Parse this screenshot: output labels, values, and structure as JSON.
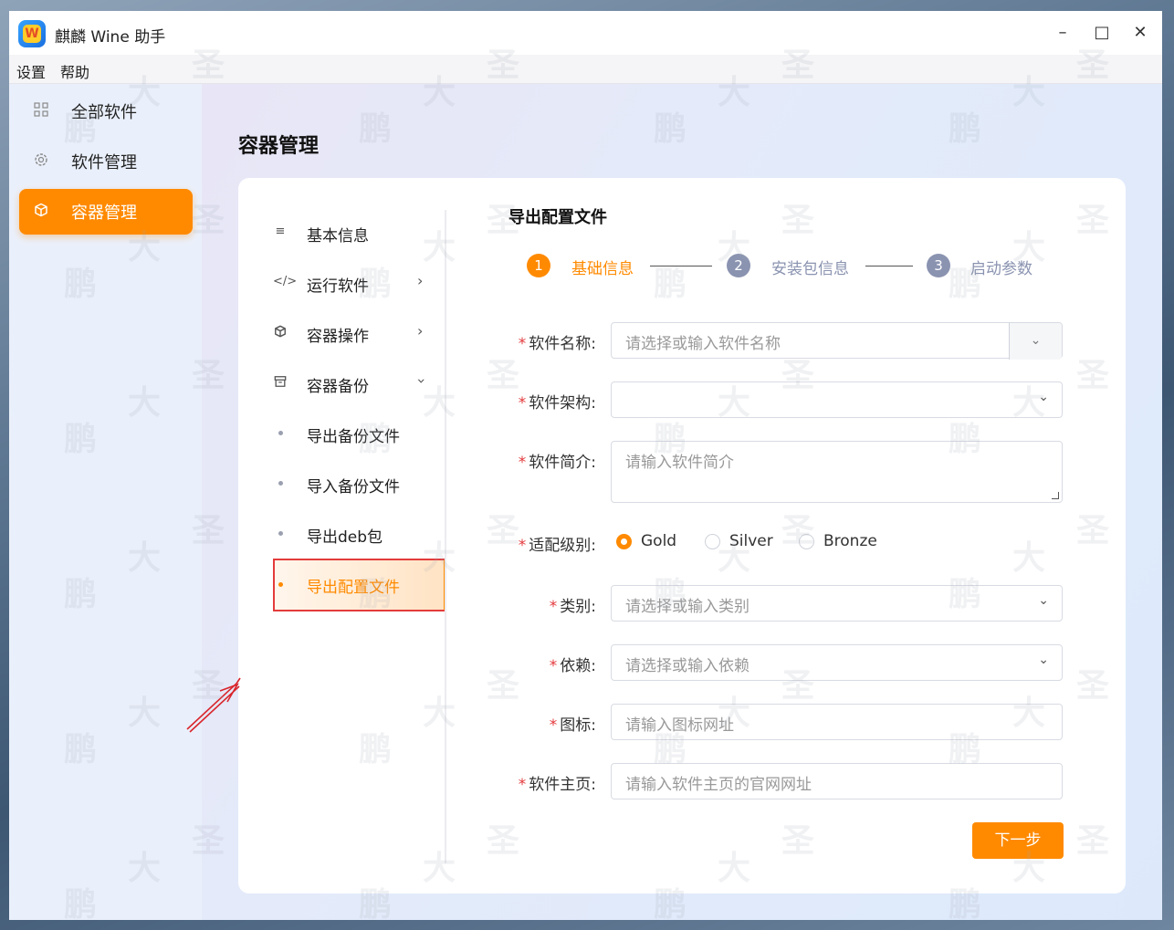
{
  "window": {
    "title": "麒麟 Wine 助手"
  },
  "menubar": [
    "设置",
    "帮助"
  ],
  "sidebar": {
    "items": [
      {
        "label": "全部软件",
        "icon": "grid-icon"
      },
      {
        "label": "软件管理",
        "icon": "gear-icon"
      },
      {
        "label": "容器管理",
        "icon": "cube-icon",
        "active": true
      }
    ]
  },
  "page": {
    "title": "容器管理"
  },
  "submenu": {
    "items": [
      {
        "label": "基本信息",
        "icon": "list-icon"
      },
      {
        "label": "运行软件",
        "icon": "code-icon"
      },
      {
        "label": "容器操作",
        "icon": "cube-icon"
      },
      {
        "label": "容器备份",
        "icon": "archive-icon"
      },
      {
        "label": "导出备份文件"
      },
      {
        "label": "导入备份文件"
      },
      {
        "label": "导出deb包"
      },
      {
        "label": "导出配置文件",
        "active": true
      }
    ]
  },
  "form": {
    "title": "导出配置文件",
    "steps": [
      {
        "num": "1",
        "label": "基础信息",
        "active": true
      },
      {
        "num": "2",
        "label": "安装包信息"
      },
      {
        "num": "3",
        "label": "启动参数"
      }
    ],
    "fields": {
      "name": {
        "label": "软件名称:",
        "placeholder": "请选择或输入软件名称"
      },
      "arch": {
        "label": "软件架构:",
        "value": ""
      },
      "desc": {
        "label": "软件简介:",
        "placeholder": "请输入软件简介"
      },
      "level": {
        "label": "适配级别:",
        "options": [
          "Gold",
          "Silver",
          "Bronze"
        ],
        "selected": "Gold"
      },
      "category": {
        "label": "类别:",
        "placeholder": "请选择或输入类别"
      },
      "depends": {
        "label": "依赖:",
        "placeholder": "请选择或输入依赖"
      },
      "icon": {
        "label": "图标:",
        "placeholder": "请输入图标网址"
      },
      "homepage": {
        "label": "软件主页:",
        "placeholder": "请输入软件主页的官网网址"
      }
    },
    "required_mark": "*",
    "next_label": "下一步"
  },
  "colors": {
    "accent": "#ff8a00",
    "highlight_border": "#e43b3b",
    "step_inactive": "#8a93b0"
  },
  "watermark": [
    "圣",
    "大",
    "鹏"
  ]
}
